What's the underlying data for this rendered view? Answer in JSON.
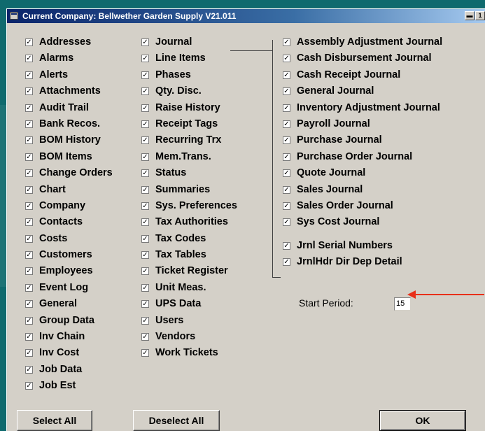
{
  "window": {
    "title": "Current Company: Bellwether Garden Supply V21.011",
    "btn_glyph_a": "▬",
    "btn_glyph_b": "1"
  },
  "columns": {
    "col1": [
      {
        "label": "Addresses",
        "checked": true
      },
      {
        "label": "Alarms",
        "checked": true
      },
      {
        "label": "Alerts",
        "checked": true
      },
      {
        "label": "Attachments",
        "checked": true
      },
      {
        "label": "Audit Trail",
        "checked": true
      },
      {
        "label": "Bank Recos.",
        "checked": true
      },
      {
        "label": "BOM History",
        "checked": true
      },
      {
        "label": "BOM Items",
        "checked": true
      },
      {
        "label": "Change Orders",
        "checked": true
      },
      {
        "label": "Chart",
        "checked": true
      },
      {
        "label": "Company",
        "checked": true
      },
      {
        "label": "Contacts",
        "checked": true
      },
      {
        "label": "Costs",
        "checked": true
      },
      {
        "label": "Customers",
        "checked": true
      },
      {
        "label": "Employees",
        "checked": true
      },
      {
        "label": "Event Log",
        "checked": true
      },
      {
        "label": "General",
        "checked": true
      },
      {
        "label": "Group Data",
        "checked": true
      },
      {
        "label": "Inv Chain",
        "checked": true
      },
      {
        "label": "Inv Cost",
        "checked": true
      },
      {
        "label": "Job Data",
        "checked": true
      },
      {
        "label": "Job Est",
        "checked": true
      }
    ],
    "col2": [
      {
        "label": "Journal",
        "checked": true
      },
      {
        "label": "Line Items",
        "checked": true
      },
      {
        "label": "Phases",
        "checked": true
      },
      {
        "label": "Qty. Disc.",
        "checked": true
      },
      {
        "label": "Raise History",
        "checked": true
      },
      {
        "label": "Receipt Tags",
        "checked": true
      },
      {
        "label": "Recurring Trx",
        "checked": true
      },
      {
        "label": "Mem.Trans.",
        "checked": true
      },
      {
        "label": "Status",
        "checked": true
      },
      {
        "label": "Summaries",
        "checked": true
      },
      {
        "label": "Sys. Preferences",
        "checked": true
      },
      {
        "label": "Tax Authorities",
        "checked": true
      },
      {
        "label": "Tax Codes",
        "checked": true
      },
      {
        "label": "Tax Tables",
        "checked": true
      },
      {
        "label": "Ticket Register",
        "checked": true
      },
      {
        "label": "Unit Meas.",
        "checked": true
      },
      {
        "label": "UPS Data",
        "checked": true
      },
      {
        "label": "Users",
        "checked": true
      },
      {
        "label": "Vendors",
        "checked": true
      },
      {
        "label": "Work Tickets",
        "checked": true
      }
    ],
    "col3": [
      {
        "label": "Assembly Adjustment Journal",
        "checked": true
      },
      {
        "label": "Cash Disbursement Journal",
        "checked": true
      },
      {
        "label": "Cash Receipt Journal",
        "checked": true
      },
      {
        "label": "General Journal",
        "checked": true
      },
      {
        "label": "Inventory Adjustment Journal",
        "checked": true
      },
      {
        "label": "Payroll Journal",
        "checked": true
      },
      {
        "label": "Purchase Journal",
        "checked": true
      },
      {
        "label": "Purchase Order Journal",
        "checked": true
      },
      {
        "label": "Quote Journal",
        "checked": true
      },
      {
        "label": "Sales Journal",
        "checked": true
      },
      {
        "label": "Sales Order Journal",
        "checked": true
      },
      {
        "label": "Sys Cost Journal",
        "checked": true
      }
    ],
    "col3b": [
      {
        "label": "Jrnl Serial Numbers",
        "checked": true
      },
      {
        "label": "JrnlHdr Dir Dep Detail",
        "checked": true
      }
    ]
  },
  "start_period": {
    "label": "Start Period:",
    "value": "15"
  },
  "buttons": {
    "select_all": "Select All",
    "deselect_all": "Deselect All",
    "ok": "OK"
  },
  "check_glyph": "☑"
}
